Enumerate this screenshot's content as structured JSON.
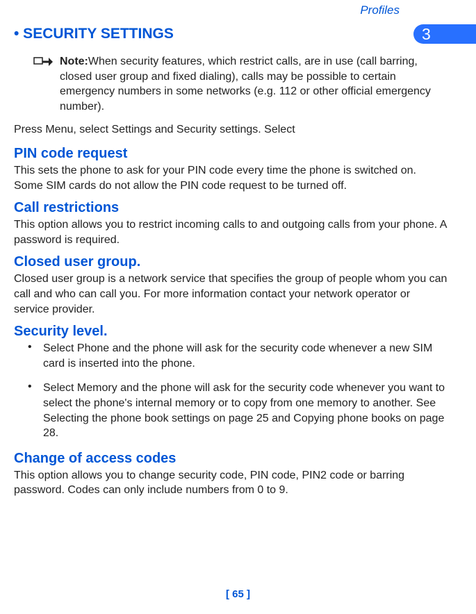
{
  "header": {
    "topic": "Profiles",
    "chapter_number": "3"
  },
  "section": {
    "heading": " •  SECURITY SETTINGS"
  },
  "note": {
    "label": "Note:",
    "text": "When security features, which restrict calls, are in use (call barring, closed user group and fixed dialing), calls may be possible to certain emergency numbers in some networks (e.g.  112 or other official emergency number)."
  },
  "instruction": "Press Menu, select Settings and Security settings. Select",
  "subsections": {
    "pin": {
      "heading": "PIN code request",
      "body": "This sets the phone to ask for your PIN code every time the phone is switched on. Some SIM cards do not allow the PIN code request to be turned off."
    },
    "call_restrictions": {
      "heading": "Call restrictions",
      "body": "This option allows you to restrict incoming calls to and outgoing calls from your phone. A password is required."
    },
    "closed_user_group": {
      "heading": "Closed user group.",
      "body": "Closed user group is a network service that specifies the group of people whom you can call and who can call you. For more information contact your network operator or service provider."
    },
    "security_level": {
      "heading": "Security level.",
      "bullets": [
        "Select Phone and the phone will ask for the security code whenever a new SIM card is inserted into the phone.",
        "Select Memory and the phone will ask for the security code whenever you want to select the phone's internal memory or to copy from one memory to another. See Selecting the phone book settings on page 25 and Copying phone books on page 28."
      ]
    },
    "change_codes": {
      "heading": "Change of access codes",
      "body": "This option allows you to change security code, PIN code, PIN2 code or barring password. Codes can only include numbers from 0 to 9."
    }
  },
  "footer": {
    "page": "[ 65 ]"
  }
}
